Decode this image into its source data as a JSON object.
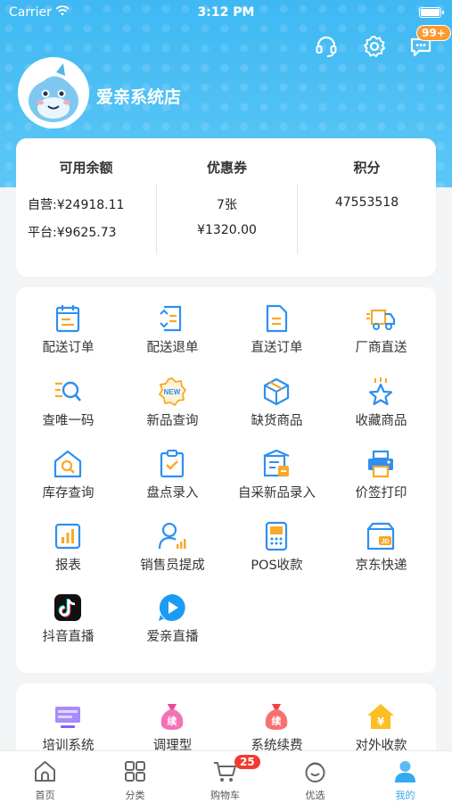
{
  "status_bar": {
    "carrier": "Carrier",
    "time": "3:12 PM"
  },
  "header": {
    "store_name": "爱亲系统店",
    "message_badge": "99+"
  },
  "balance": {
    "available_title": "可用余额",
    "self_operated": "自营:¥24918.11",
    "platform": "平台:¥9625.73",
    "coupon_title": "优惠券",
    "coupon_count": "7张",
    "coupon_amount": "¥1320.00",
    "points_title": "积分",
    "points_value": "47553518"
  },
  "menu": [
    {
      "label": "配送订单",
      "icon": "delivery-order-icon"
    },
    {
      "label": "配送退单",
      "icon": "delivery-return-icon"
    },
    {
      "label": "直送订单",
      "icon": "direct-order-icon"
    },
    {
      "label": "厂商直送",
      "icon": "truck-icon"
    },
    {
      "label": "查唯一码",
      "icon": "search-code-icon"
    },
    {
      "label": "新品查询",
      "icon": "new-badge-icon"
    },
    {
      "label": "缺货商品",
      "icon": "box-icon"
    },
    {
      "label": "收藏商品",
      "icon": "star-icon"
    },
    {
      "label": "库存查询",
      "icon": "warehouse-search-icon"
    },
    {
      "label": "盘点录入",
      "icon": "clipboard-check-icon"
    },
    {
      "label": "自采新品录入",
      "icon": "register-icon"
    },
    {
      "label": "价签打印",
      "icon": "printer-icon"
    },
    {
      "label": "报表",
      "icon": "report-chart-icon"
    },
    {
      "label": "销售员提成",
      "icon": "salesperson-icon"
    },
    {
      "label": "POS收款",
      "icon": "pos-icon"
    },
    {
      "label": "京东快递",
      "icon": "jd-express-icon"
    },
    {
      "label": "抖音直播",
      "icon": "douyin-icon"
    },
    {
      "label": "爱亲直播",
      "icon": "live-play-icon"
    }
  ],
  "services": [
    {
      "label": "培训系统",
      "icon": "training-icon"
    },
    {
      "label": "调理型",
      "icon": "bag-icon",
      "glyph": "续"
    },
    {
      "label": "系统续费",
      "icon": "renew-bag-icon",
      "glyph": "续"
    },
    {
      "label": "对外收款",
      "icon": "house-yen-icon",
      "glyph": "¥"
    }
  ],
  "tabbar": {
    "items": [
      {
        "label": "首页",
        "icon": "home-icon"
      },
      {
        "label": "分类",
        "icon": "category-icon"
      },
      {
        "label": "购物车",
        "icon": "cart-icon"
      },
      {
        "label": "优选",
        "icon": "selection-icon"
      },
      {
        "label": "我的",
        "icon": "profile-icon"
      }
    ],
    "cart_badge": "25"
  },
  "colors": {
    "brand_blue": "#3fb8f3",
    "icon_blue": "#2f8ff0",
    "icon_orange": "#f7a928",
    "badge_red": "#f23b2f"
  }
}
